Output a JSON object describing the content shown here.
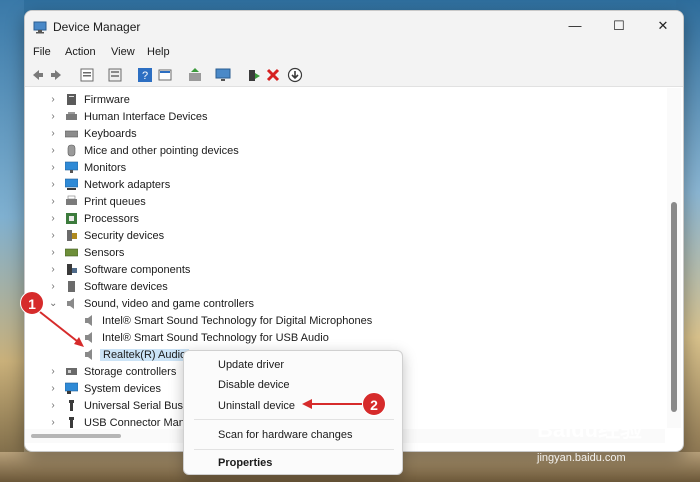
{
  "window": {
    "title": "Device Manager",
    "controls": {
      "minimize": "—",
      "maximize": "☐",
      "close": "✕"
    }
  },
  "menubar": [
    "File",
    "Action",
    "View",
    "Help"
  ],
  "toolbar": {
    "icons": [
      "back-arrow-icon",
      "forward-arrow-icon",
      "properties-icon",
      "show-hidden-icon",
      "help-icon",
      "view-icon",
      "update-driver-icon",
      "monitor-scan-icon",
      "enable-device-icon",
      "uninstall-x-icon",
      "download-icon"
    ]
  },
  "tree": [
    {
      "label": "Firmware",
      "chevron": "›",
      "icon": "firmware-icon",
      "color": "#5a5a5a"
    },
    {
      "label": "Human Interface Devices",
      "chevron": "›",
      "icon": "hid-icon",
      "color": "#7a7a7a"
    },
    {
      "label": "Keyboards",
      "chevron": "›",
      "icon": "keyboard-icon",
      "color": "#8c8c8c"
    },
    {
      "label": "Mice and other pointing devices",
      "chevron": "›",
      "icon": "mouse-icon",
      "color": "#9a9a9a"
    },
    {
      "label": "Monitors",
      "chevron": "›",
      "icon": "monitor-icon",
      "color": "#2f8ad6"
    },
    {
      "label": "Network adapters",
      "chevron": "›",
      "icon": "network-icon",
      "color": "#2f8ad6"
    },
    {
      "label": "Print queues",
      "chevron": "›",
      "icon": "printer-icon",
      "color": "#7b7b7b"
    },
    {
      "label": "Processors",
      "chevron": "›",
      "icon": "processor-icon",
      "color": "#3c7b3c"
    },
    {
      "label": "Security devices",
      "chevron": "›",
      "icon": "security-icon",
      "color": "#b08a1e"
    },
    {
      "label": "Sensors",
      "chevron": "›",
      "icon": "sensor-icon",
      "color": "#6e8f3a"
    },
    {
      "label": "Software components",
      "chevron": "›",
      "icon": "software-component-icon",
      "color": "#4f6b8a"
    },
    {
      "label": "Software devices",
      "chevron": "›",
      "icon": "software-device-icon",
      "color": "#6b6b6b"
    },
    {
      "label": "Sound, video and game controllers",
      "chevron": "⌄",
      "icon": "speaker-icon",
      "color": "#8a8a8a"
    },
    {
      "label": "Intel® Smart Sound Technology for Digital Microphones",
      "chevron": "",
      "icon": "speaker-icon",
      "color": "#8a8a8a"
    },
    {
      "label": "Intel® Smart Sound Technology for USB Audio",
      "chevron": "",
      "icon": "speaker-icon",
      "color": "#8a8a8a"
    },
    {
      "label": "Realtek(R) Audio",
      "chevron": "",
      "icon": "speaker-icon",
      "color": "#8a8a8a"
    },
    {
      "label": "Storage controllers",
      "chevron": "›",
      "icon": "storage-icon",
      "color": "#6a6a6a"
    },
    {
      "label": "System devices",
      "chevron": "›",
      "icon": "system-icon",
      "color": "#2f8ad6"
    },
    {
      "label": "Universal Serial Bus c",
      "chevron": "›",
      "icon": "usb-icon",
      "color": "#3a3a3a"
    },
    {
      "label": "USB Connector Mana",
      "chevron": "›",
      "icon": "usb-icon",
      "color": "#3a3a3a"
    }
  ],
  "context_menu": {
    "items": [
      "Update driver",
      "Disable device",
      "Uninstall device",
      "Scan for hardware changes",
      "Properties"
    ]
  },
  "annotations": {
    "badge1": "1",
    "badge2": "2",
    "color": "#d62b2b"
  },
  "watermark": {
    "logo": "Baidu经验",
    "url": "jingyan.baidu.com"
  }
}
